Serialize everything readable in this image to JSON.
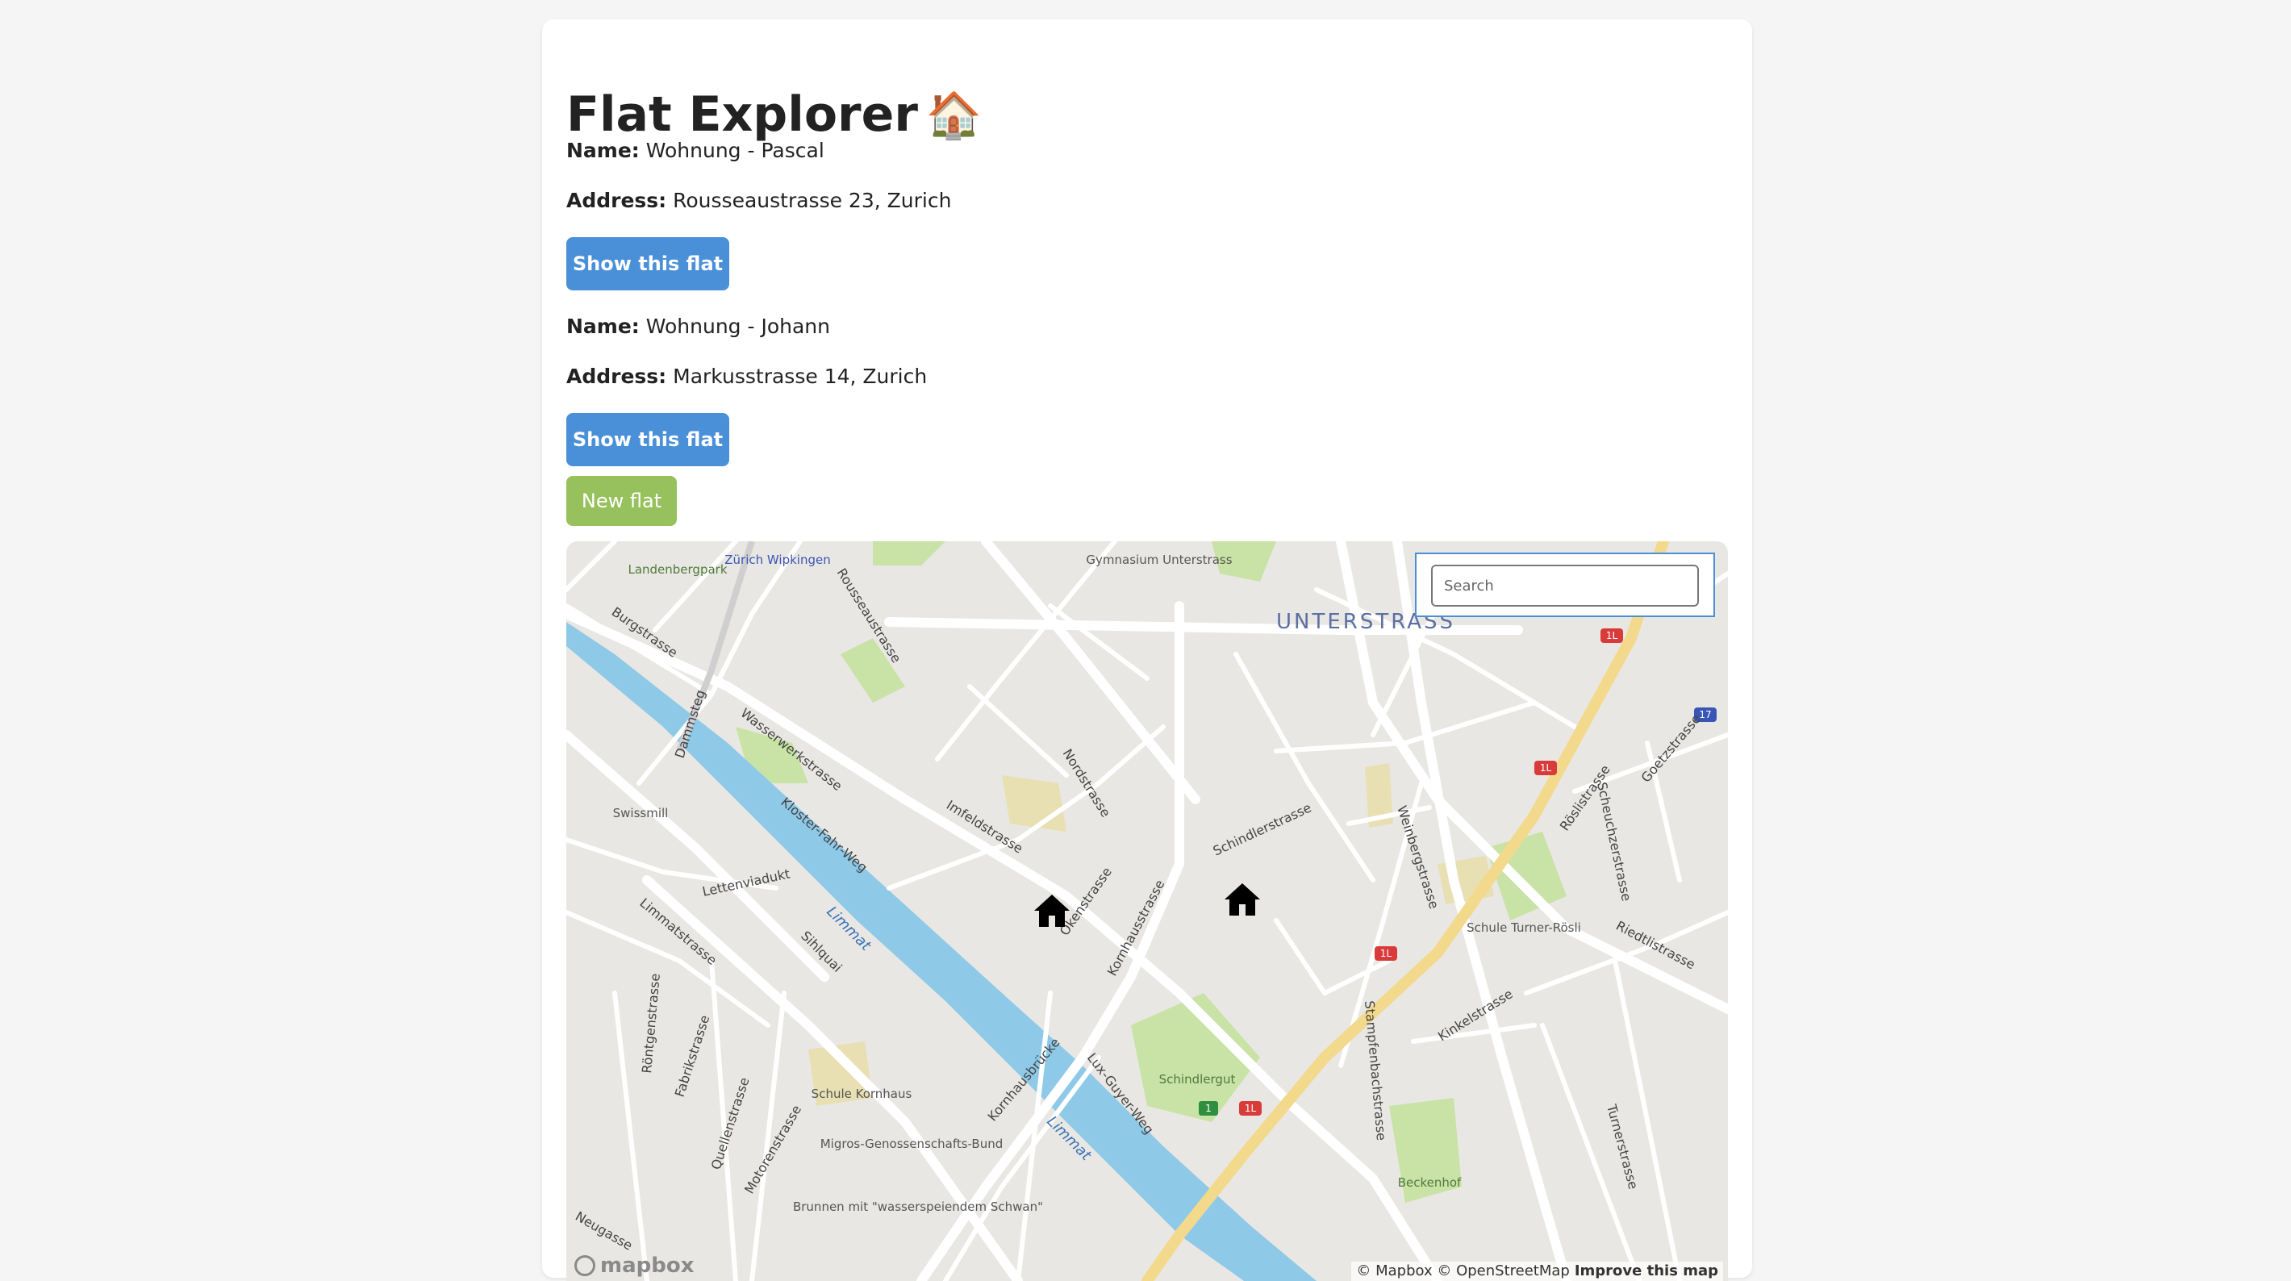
{
  "header": {
    "title": "Flat Explorer",
    "title_emoji": "🏠"
  },
  "flats": [
    {
      "name_label": "Name:",
      "name": "Wohnung - Pascal",
      "address_label": "Address:",
      "address": "Rousseaustrasse 23, Zurich",
      "button_label": "Show this flat"
    },
    {
      "name_label": "Name:",
      "name": "Wohnung - Johann",
      "address_label": "Address:",
      "address": "Markusstrasse 14, Zurich",
      "button_label": "Show this flat"
    }
  ],
  "new_flat_button": "New flat",
  "map": {
    "search": {
      "placeholder": "Search"
    },
    "district_label": "UNTERSTRASS",
    "street_labels": [
      "Wasserwerkstrasse",
      "Rousseaustrasse",
      "Nordstrasse",
      "Kornhausstrasse",
      "Schindlerstrasse",
      "Weinbergstrasse",
      "Riedtlistrasse",
      "Limmatstrasse",
      "Sihlquai",
      "Imfeldstrasse",
      "Okenstrasse",
      "Stampfenbachstrasse",
      "Kinkelstrasse",
      "Burgstrasse",
      "Kornhausbrücke",
      "Röslistrasse",
      "Scheuchzerstrasse",
      "Goetzstrasse",
      "Lettenviadukt",
      "Röntgenstrasse",
      "Fabrikstrasse",
      "Quellenstrasse",
      "Motorenstrasse",
      "Kloster-Fahr-Weg",
      "Dammsteg",
      "Turnerstrasse",
      "Lux-Guyer-Weg",
      "Neugasse"
    ],
    "water_labels": [
      "Limmat",
      "Limmat"
    ],
    "poi_labels": [
      "Landenbergpark",
      "Zürich Wipkingen",
      "Gymnasium Unterstrass",
      "Swissmill",
      "Schule Turner-Rösli",
      "Schindlergut",
      "Schule Kornhaus",
      "Migros-Genossenschafts-Bund",
      "Brunnen mit \"wasserspeiendem Schwan\"",
      "Beckenhof"
    ],
    "route_shields": [
      "1L",
      "1L",
      "1L",
      "1L",
      "17",
      "1"
    ],
    "attribution": "© Mapbox © OpenStreetMap",
    "improve_link": "Improve this map",
    "logo_text": "mapbox",
    "markers": [
      "house-marker",
      "house-marker"
    ]
  },
  "colors": {
    "primary_button": "#4a90d9",
    "success_button": "#97c15c",
    "water": "#8ecae8",
    "park": "#c8e3a5",
    "map_background": "#e9e7e3",
    "major_road": "#f3d98c",
    "route_shield": "#d93b3b"
  }
}
